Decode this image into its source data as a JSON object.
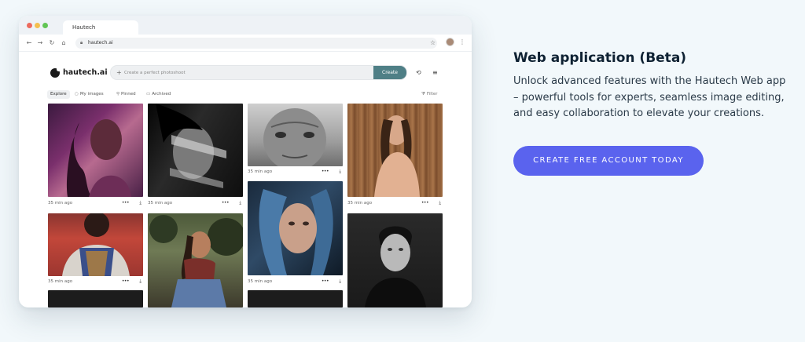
{
  "browser": {
    "tab_title": "Hautech",
    "url": "hautech.ai",
    "icons": [
      "back-arrow-icon",
      "forward-arrow-icon",
      "reload-icon",
      "home-icon",
      "lock-icon",
      "star-icon",
      "profile-avatar",
      "kebab-menu-icon"
    ]
  },
  "app": {
    "logo_text": "hautech.ai",
    "prompt_placeholder": "Create a perfect photoshoot",
    "create_label": "Create",
    "filters": {
      "explore": "Explore",
      "my_images": "My images",
      "pinned": "Pinned",
      "archived": "Archived",
      "filter": "Filter"
    },
    "cards": [
      {
        "time": "35 min ago",
        "tone": "magenta-portrait"
      },
      {
        "time": "35 min ago",
        "tone": "mono-shadow-portrait"
      },
      {
        "time": "35 min ago",
        "tone": "elderly-mono-portrait"
      },
      {
        "time": "35 min ago",
        "tone": "wood-wall-portrait"
      },
      {
        "time": "35 min ago",
        "tone": "patterned-vest-portrait"
      },
      {
        "time": "",
        "tone": "outdoor-sitting-portrait"
      },
      {
        "time": "35 min ago",
        "tone": "blue-hair-portrait"
      },
      {
        "time": "",
        "tone": "studio-dark-portrait"
      }
    ]
  },
  "promo": {
    "heading": "Web application (Beta)",
    "description": "Unlock advanced features with the Hautech Web app – powerful tools for experts, seamless image editing, and easy collaboration to elevate your creations.",
    "cta_label": "CREATE FREE ACCOUNT TODAY",
    "cta_color": "#5a63ee"
  }
}
